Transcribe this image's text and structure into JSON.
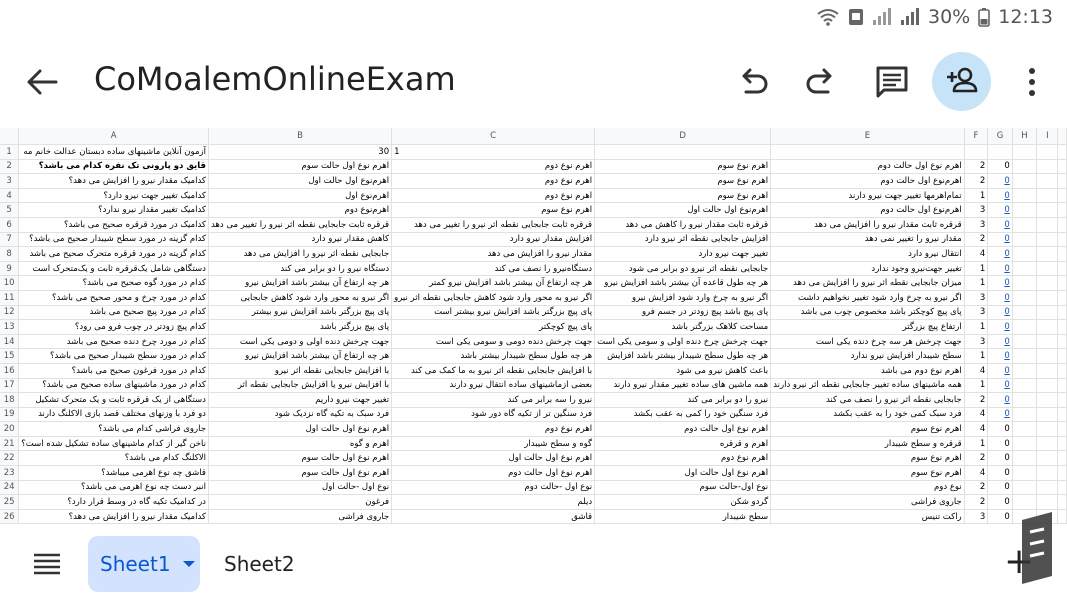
{
  "status_bar": {
    "battery": "30%",
    "time": "12:13"
  },
  "app_bar": {
    "title": "CoMoalemOnlineExam"
  },
  "columns": [
    "A",
    "B",
    "C",
    "D",
    "E",
    "F",
    "G",
    "H",
    "I"
  ],
  "rows": [
    {
      "n": "1",
      "a": "آزمون آنلاین ماشینهای ساده دبستان عدالت خانم مه",
      "b": "30",
      "c": "1",
      "d": "",
      "e": "",
      "f": "",
      "g": ""
    },
    {
      "n": "2",
      "a": "قایق دو پارونی تک نفره کدام می باشد؟",
      "b": "اهرم نوع اول حالت سوم",
      "c": "اهرم نوع دوم",
      "d": "اهرم نوع سوم",
      "e": "اهرم نوع اول حالت دوم",
      "f": "2",
      "g": "0"
    },
    {
      "n": "3",
      "a": "کدامیک مقدار نیرو را افزایش می دهد؟",
      "b": "اهرم‌نوع اول حالت اول",
      "c": "اهرم نوع دوم",
      "d": "اهرم نوع سوم",
      "e": "اهرم‌نوع اول حالت دوم",
      "f": "2",
      "g": "0"
    },
    {
      "n": "4",
      "a": "کدامیک تغییر جهت نیرو دارد؟",
      "b": "اهرم‌نوع اول",
      "c": "اهرم نوع دوم",
      "d": "اهرم نوع سوم",
      "e": "تمام‌اهرمها تغییر جهت نیرو دارند",
      "f": "1",
      "g": "0"
    },
    {
      "n": "5",
      "a": "کدامیک تغییر مقدار نیرو ندارد؟",
      "b": "اهرم‌نوع دوم",
      "c": "اهرم نوع سوم",
      "d": "اهرم‌نوع اول حالت اول",
      "e": "اهرم‌نوع اول حالت دوم",
      "f": "3",
      "g": "0"
    },
    {
      "n": "6",
      "a": "کدامیک در مورد قرقره صحیح می باشد؟",
      "b": "قرقره ثابت جابجایی نقطه اثر نیرو را تغییر می دهد",
      "c": "قرقره ثابت جابجایی نقطه اثر نیرو را تغییر می دهد",
      "d": "قرقره ثابت مقدار نیرو را کاهش می دهد",
      "e": "قرقره ثابت مقدار نیرو را افزایش می دهد",
      "f": "3",
      "g": "0"
    },
    {
      "n": "7",
      "a": "کدام گزینه در مورد سطح شیبدار صحیح می باشد؟",
      "b": "کاهش مقدار نیرو دارد",
      "c": "افزایش مقدار نیرو دارد",
      "d": "افزایش جابجایی نقطه اثر نیرو دارد",
      "e": "مقدار نیرو را تغییر نمی دهد",
      "f": "2",
      "g": "0"
    },
    {
      "n": "8",
      "a": "کدام گزینه در مورد قرقره متحرک صحیح می باشد",
      "b": "جابجایی نقطه اثر نیرو را افزایش می دهد",
      "c": "مقدار نیرو را افزایش می دهد",
      "d": "تغییر جهت نیرو دارد",
      "e": "انتقال نیرو دارد",
      "f": "4",
      "g": "0"
    },
    {
      "n": "9",
      "a": "دستگاهی شامل یک‌قرقره ثابت و یک‌متحرک است",
      "b": "دستگاه نیرو را دو برابر می کند",
      "c": "دستگاه‌نیرو را نصف می کند",
      "d": "جابجایی نقطه اثر نیرو دو برابر می شود",
      "e": "تغییر جهت‌نیرو وجود ندارد",
      "f": "1",
      "g": "0"
    },
    {
      "n": "10",
      "a": "کدام در مورد گوه صحیح می باشد؟",
      "b": "هر چه ارتفاع آن بیشتر باشد افزایش نیرو",
      "c": "هر چه ارتفاع آن بیشتر باشد افزایش نیرو کمتر",
      "d": "هر چه طول قاعده آن بیشتر باشد افزایش نیرو",
      "e": "میزان جابجایی نقطه اثر نیرو را افزایش می دهد",
      "f": "1",
      "g": "0"
    },
    {
      "n": "11",
      "a": "کدام در مورد چرخ و محور صحیح می باشد؟",
      "b": "اگر نیرو به محور وارد شود کاهش جابجایی",
      "c": "اگر نیرو به محور وارد شود کاهش جابجایی نقطه اثر نیرو",
      "d": "اگر نیرو به چرخ وارد شود افزایش نیرو",
      "e": "اگر نیرو به چرخ وارد شود تغییر نخواهیم داشت",
      "f": "3",
      "g": "0"
    },
    {
      "n": "12",
      "a": "کدام در مورد پیچ صحیح می باشد",
      "b": "پای پیچ بزرگتر باشد افزایش نیرو بیشتر",
      "c": "پای پیچ بزرگتر باشد افزایش نیرو بیشتر است",
      "d": "پای پیچ باشد پیچ زودتر در جسم فرو",
      "e": "پای پیچ کوچکتر باشد مخصوص چوب می باشد",
      "f": "3",
      "g": "0"
    },
    {
      "n": "13",
      "a": "کدام پیچ زودتر در چوب فرو می رود؟",
      "b": "پای پیچ بزرگتر باشد",
      "c": "پای پیچ کوچکتر",
      "d": "مساحت کلاهک بزرگتر باشد",
      "e": "ارتفاع پیچ بزرگتر",
      "f": "1",
      "g": "0"
    },
    {
      "n": "14",
      "a": "کدام در مورد چرخ دنده صحیح می باشد",
      "b": "جهت چرخش دنده اولی و دومی یکی است",
      "c": "جهت چرخش دنده دومی و سومی یکی است",
      "d": "جهت چرخش چرخ دنده اولی و سومی یکی است",
      "e": "جهت چرخش هر سه چرخ دنده یکی است",
      "f": "3",
      "g": "0"
    },
    {
      "n": "15",
      "a": "کدام در مورد سطح شیبدار صحیح می باشد؟",
      "b": "هر چه ارتفاع آن بیشتر باشد افزایش نیرو",
      "c": "هر چه طول سطح شیبدار بیشتر باشد",
      "d": "هر چه طول سطح شیبدار بیشتر باشد افزایش",
      "e": "سطح شیبدار افزایش نیرو ندارد",
      "f": "1",
      "g": "0"
    },
    {
      "n": "16",
      "a": "کدام در مورد فرغون صحیح می باشد؟",
      "b": "با افزایش جابجایی نقطه اثر نیرو",
      "c": "با افزایش جابجایی نقطه اثر نیرو به ما کمک می کند",
      "d": "باعث کاهش نیرو می شود",
      "e": "اهرم نوع دوم می باشد",
      "f": "4",
      "g": "0"
    },
    {
      "n": "17",
      "a": "کدام در مورد ماشینهای ساده صحیح می باشد؟",
      "b": "با افزایش نیرو یا افزایش جابجایی نقطه اثر",
      "c": "بعضی ازماشینهای ساده انتقال نیرو دارند",
      "d": "همه ماشین های ساده تغییر مقدار نیرو دارند",
      "e": "همه ماشینهای ساده تغییر جابجایی نقطه اثر نیرو دارند",
      "f": "1",
      "g": "0"
    },
    {
      "n": "18",
      "a": "دستگاهی از یک قرقره ثابت و یک متحرک تشکیل",
      "b": "تغییر جهت نیرو داریم",
      "c": "نیرو را سه برابر می کند",
      "d": "نیرو را دو برابر می کند",
      "e": "جابجایی نقطه اثر نیرو را نصف می کند",
      "f": "2",
      "g": "0"
    },
    {
      "n": "19",
      "a": "دو فرد با وزنهای مختلف قصد بازی الاکلنگ دارند",
      "b": "فرد سبک به تکیه گاه نزدیک شود",
      "c": "فرد سنگین تر از تکیه گاه دور شود",
      "d": "فرد سنگین خود را کمی به عقب بکشد",
      "e": "فرد سبک کمی خود را به عقب بکشد",
      "f": "4",
      "g": "0"
    },
    {
      "n": "20",
      "a": "جاروی فراشی کدام می باشد؟",
      "b": "اهرم نوع اول حالت اول",
      "c": "اهرم نوع دوم",
      "d": "اهرم نوع اول حالت دوم",
      "e": "اهرم نوع سوم",
      "f": "4",
      "g": "0"
    },
    {
      "n": "21",
      "a": "ناخن گیر از کدام ماشینهای ساده تشکیل شده است؟",
      "b": "اهرم و گوه",
      "c": "گوه و سطح شیبدار",
      "d": "اهرم و قرقره",
      "e": "قرقره و سطح شیبدار",
      "f": "1",
      "g": "0"
    },
    {
      "n": "22",
      "a": "الاکلنگ کدام می باشد؟",
      "b": "اهرم نوع اول حالت سوم",
      "c": "اهرم نوع اول حالت اول",
      "d": "اهرم نوع دوم",
      "e": "اهرم نوع سوم",
      "f": "2",
      "g": "0"
    },
    {
      "n": "23",
      "a": "قاشق چه نوع اهرمی میباشد؟",
      "b": "اهرم نوع اول حالت سوم",
      "c": "اهرم نوع اول حالت دوم",
      "d": "اهرم نوع اول حالت اول",
      "e": "اهرم نوع سوم",
      "f": "4",
      "g": "0"
    },
    {
      "n": "24",
      "a": "انبر دست چه نوع اهرمی می باشد؟",
      "b": "نوع اول -حالت اول",
      "c": "نوع اول -حالت دوم",
      "d": "نوع اول-حالت سوم",
      "e": "نوع دوم",
      "f": "2",
      "g": "0"
    },
    {
      "n": "25",
      "a": "در کدامیک تکیه گاه در وسط قرار دارد؟",
      "b": "فرغون",
      "c": "دیلم",
      "d": "گردو شکن",
      "e": "جاروی فراشی",
      "f": "2",
      "g": "0"
    },
    {
      "n": "26",
      "a": "کدامیک مقدار نیرو را افزایش می دهد؟",
      "b": "جاروی فراشی",
      "c": "قاشق",
      "d": "سطح شیبدار",
      "e": "راکت تنیس",
      "f": "3",
      "g": "0"
    }
  ],
  "bottom_bar": {
    "sheet1_label": "Sheet1",
    "sheet2_label": "Sheet2",
    "add_label": "+"
  }
}
